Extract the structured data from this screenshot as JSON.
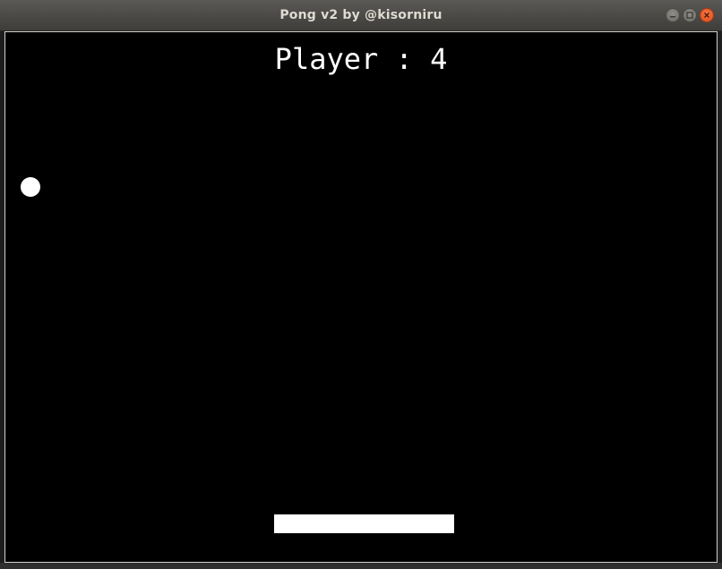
{
  "window": {
    "title": "Pong v2 by @kisorniru"
  },
  "controls": {
    "minimize_icon": "minimize-icon",
    "maximize_icon": "maximize-icon",
    "close_icon": "close-icon"
  },
  "game": {
    "score_text": "Player : 4",
    "background_color": "#000000",
    "object_color": "#ffffff"
  }
}
